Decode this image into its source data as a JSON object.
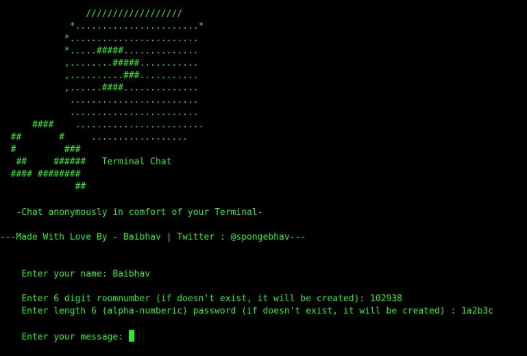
{
  "colors": {
    "background": "#000000",
    "text": "#22f022",
    "cursor": "#22f022"
  },
  "banner": {
    "art": "                //////////////////\n             *.......................*\n            *........................\n            *.....#####..............\n            ,........#####...........\n            ,..........###...........\n            ,......####..............\n             ........................\n             ........................\n      ####    ........................\n  ##       #     ..................\n  #         ###\n   ##     ######   Terminal Chat\n  #### ########\n              ##"
  },
  "tagline": "   -Chat anonymously in comfort of your Terminal-",
  "credits": "---Made With Love By - Baibhav | Twitter : @spongebhav---",
  "prompts": {
    "name_label": "Enter your name: ",
    "name_value": "Baibhav",
    "room_label": "Enter 6 digit roomnumber (if doesn't exist, it will be created): ",
    "room_value": "102938",
    "password_label": "Enter length 6 (alpha-numberic) password (if doesn't exist, it will be created) : ",
    "password_value": "1a2b3c",
    "message_label": "Enter your message: "
  }
}
